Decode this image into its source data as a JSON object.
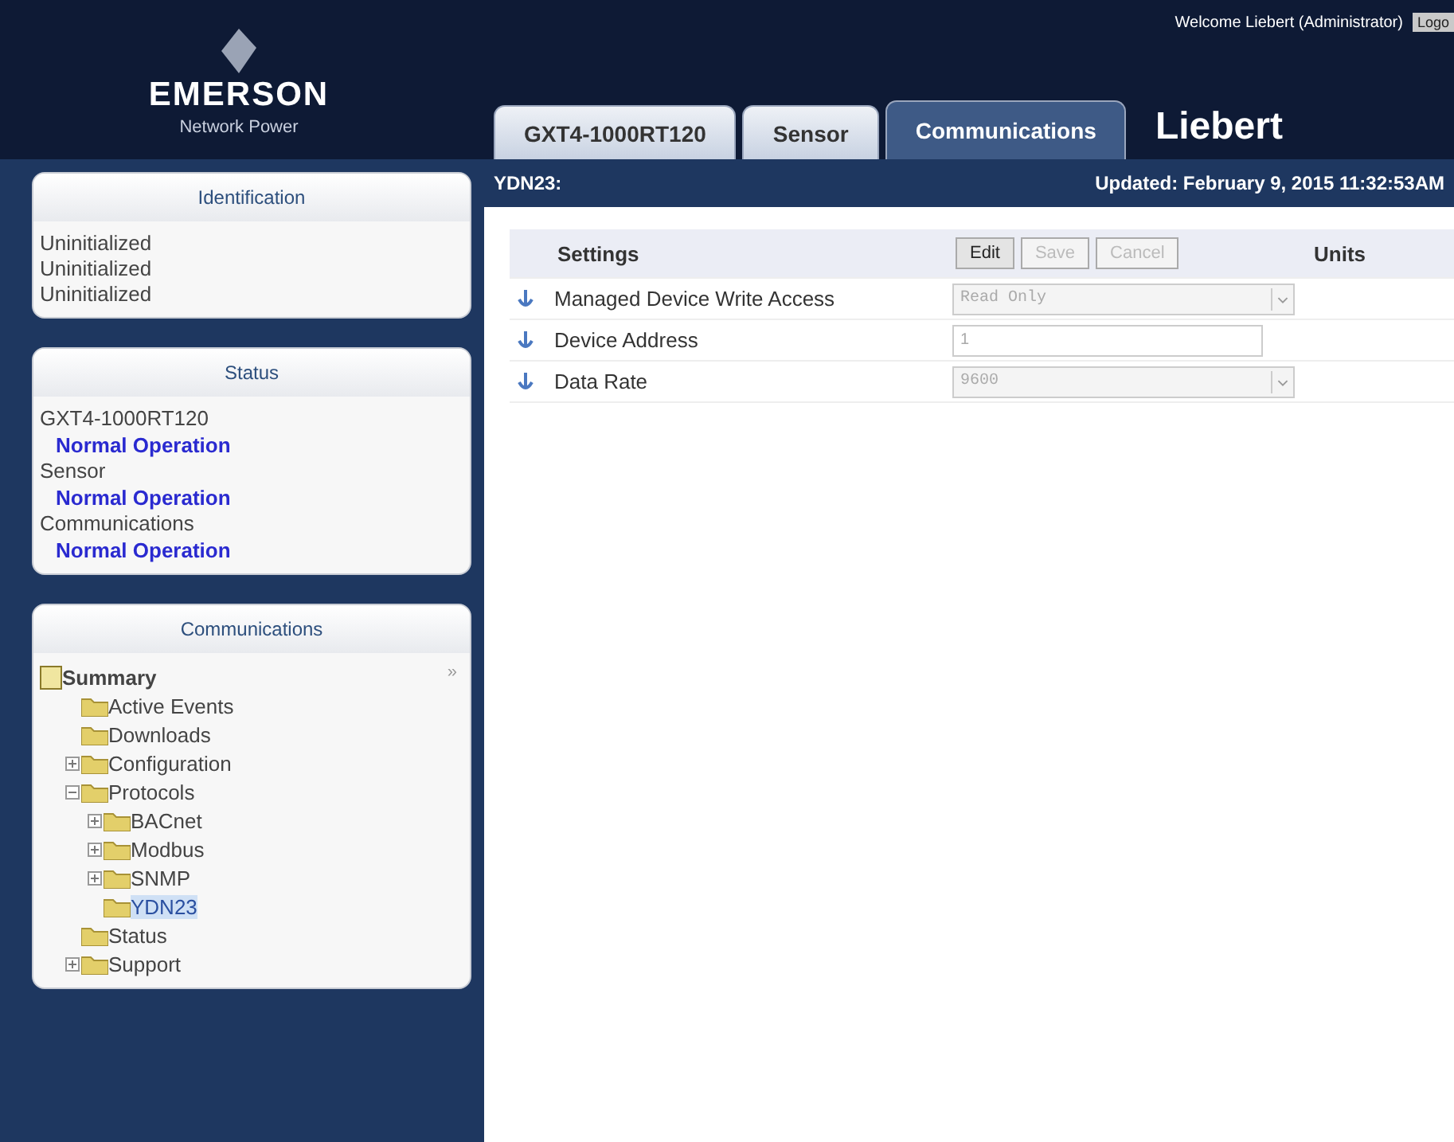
{
  "header": {
    "brand": "EMERSON",
    "brand_sub": "Network Power",
    "welcome": "Welcome Liebert (Administrator)",
    "logout": "Logo",
    "product": "Liebert"
  },
  "tabs": [
    {
      "label": "GXT4-1000RT120",
      "selected": false
    },
    {
      "label": "Sensor",
      "selected": false
    },
    {
      "label": "Communications",
      "selected": true
    }
  ],
  "subbar": {
    "path": "YDN23:",
    "updated": "Updated: February 9, 2015 11:32:53AM"
  },
  "identification": {
    "title": "Identification",
    "lines": [
      "Uninitialized",
      "Uninitialized",
      "Uninitialized"
    ]
  },
  "status": {
    "title": "Status",
    "items": [
      {
        "device": "GXT4-1000RT120",
        "state": "Normal Operation"
      },
      {
        "device": "Sensor",
        "state": "Normal Operation"
      },
      {
        "device": "Communications",
        "state": "Normal Operation"
      }
    ]
  },
  "communications": {
    "title": "Communications",
    "collapse": "»",
    "tree": [
      {
        "label": "Summary",
        "kind": "page",
        "selected": false,
        "children": [
          {
            "label": "Active Events",
            "kind": "folder",
            "selected": false
          },
          {
            "label": "Downloads",
            "kind": "folder",
            "selected": false
          },
          {
            "label": "Configuration",
            "kind": "folder",
            "selected": false,
            "expanded": false
          },
          {
            "label": "Protocols",
            "kind": "folder",
            "selected": false,
            "expanded": true,
            "children": [
              {
                "label": "BACnet",
                "kind": "folder",
                "selected": false,
                "expanded": false
              },
              {
                "label": "Modbus",
                "kind": "folder",
                "selected": false,
                "expanded": false
              },
              {
                "label": "SNMP",
                "kind": "folder",
                "selected": false,
                "expanded": false
              },
              {
                "label": "YDN23",
                "kind": "folder",
                "selected": true
              }
            ]
          },
          {
            "label": "Status",
            "kind": "folder",
            "selected": false
          },
          {
            "label": "Support",
            "kind": "folder",
            "selected": false,
            "expanded": false
          }
        ]
      }
    ]
  },
  "settings": {
    "columns": {
      "settings": "Settings",
      "units": "Units"
    },
    "buttons": [
      {
        "label": "Edit",
        "disabled": false
      },
      {
        "label": "Save",
        "disabled": true
      },
      {
        "label": "Cancel",
        "disabled": true
      }
    ],
    "rows": [
      {
        "name": "Managed Device Write Access",
        "kind": "select",
        "value": "Read Only"
      },
      {
        "name": "Device Address",
        "kind": "input",
        "value": "1"
      },
      {
        "name": "Data Rate",
        "kind": "select",
        "value": "9600"
      }
    ]
  }
}
